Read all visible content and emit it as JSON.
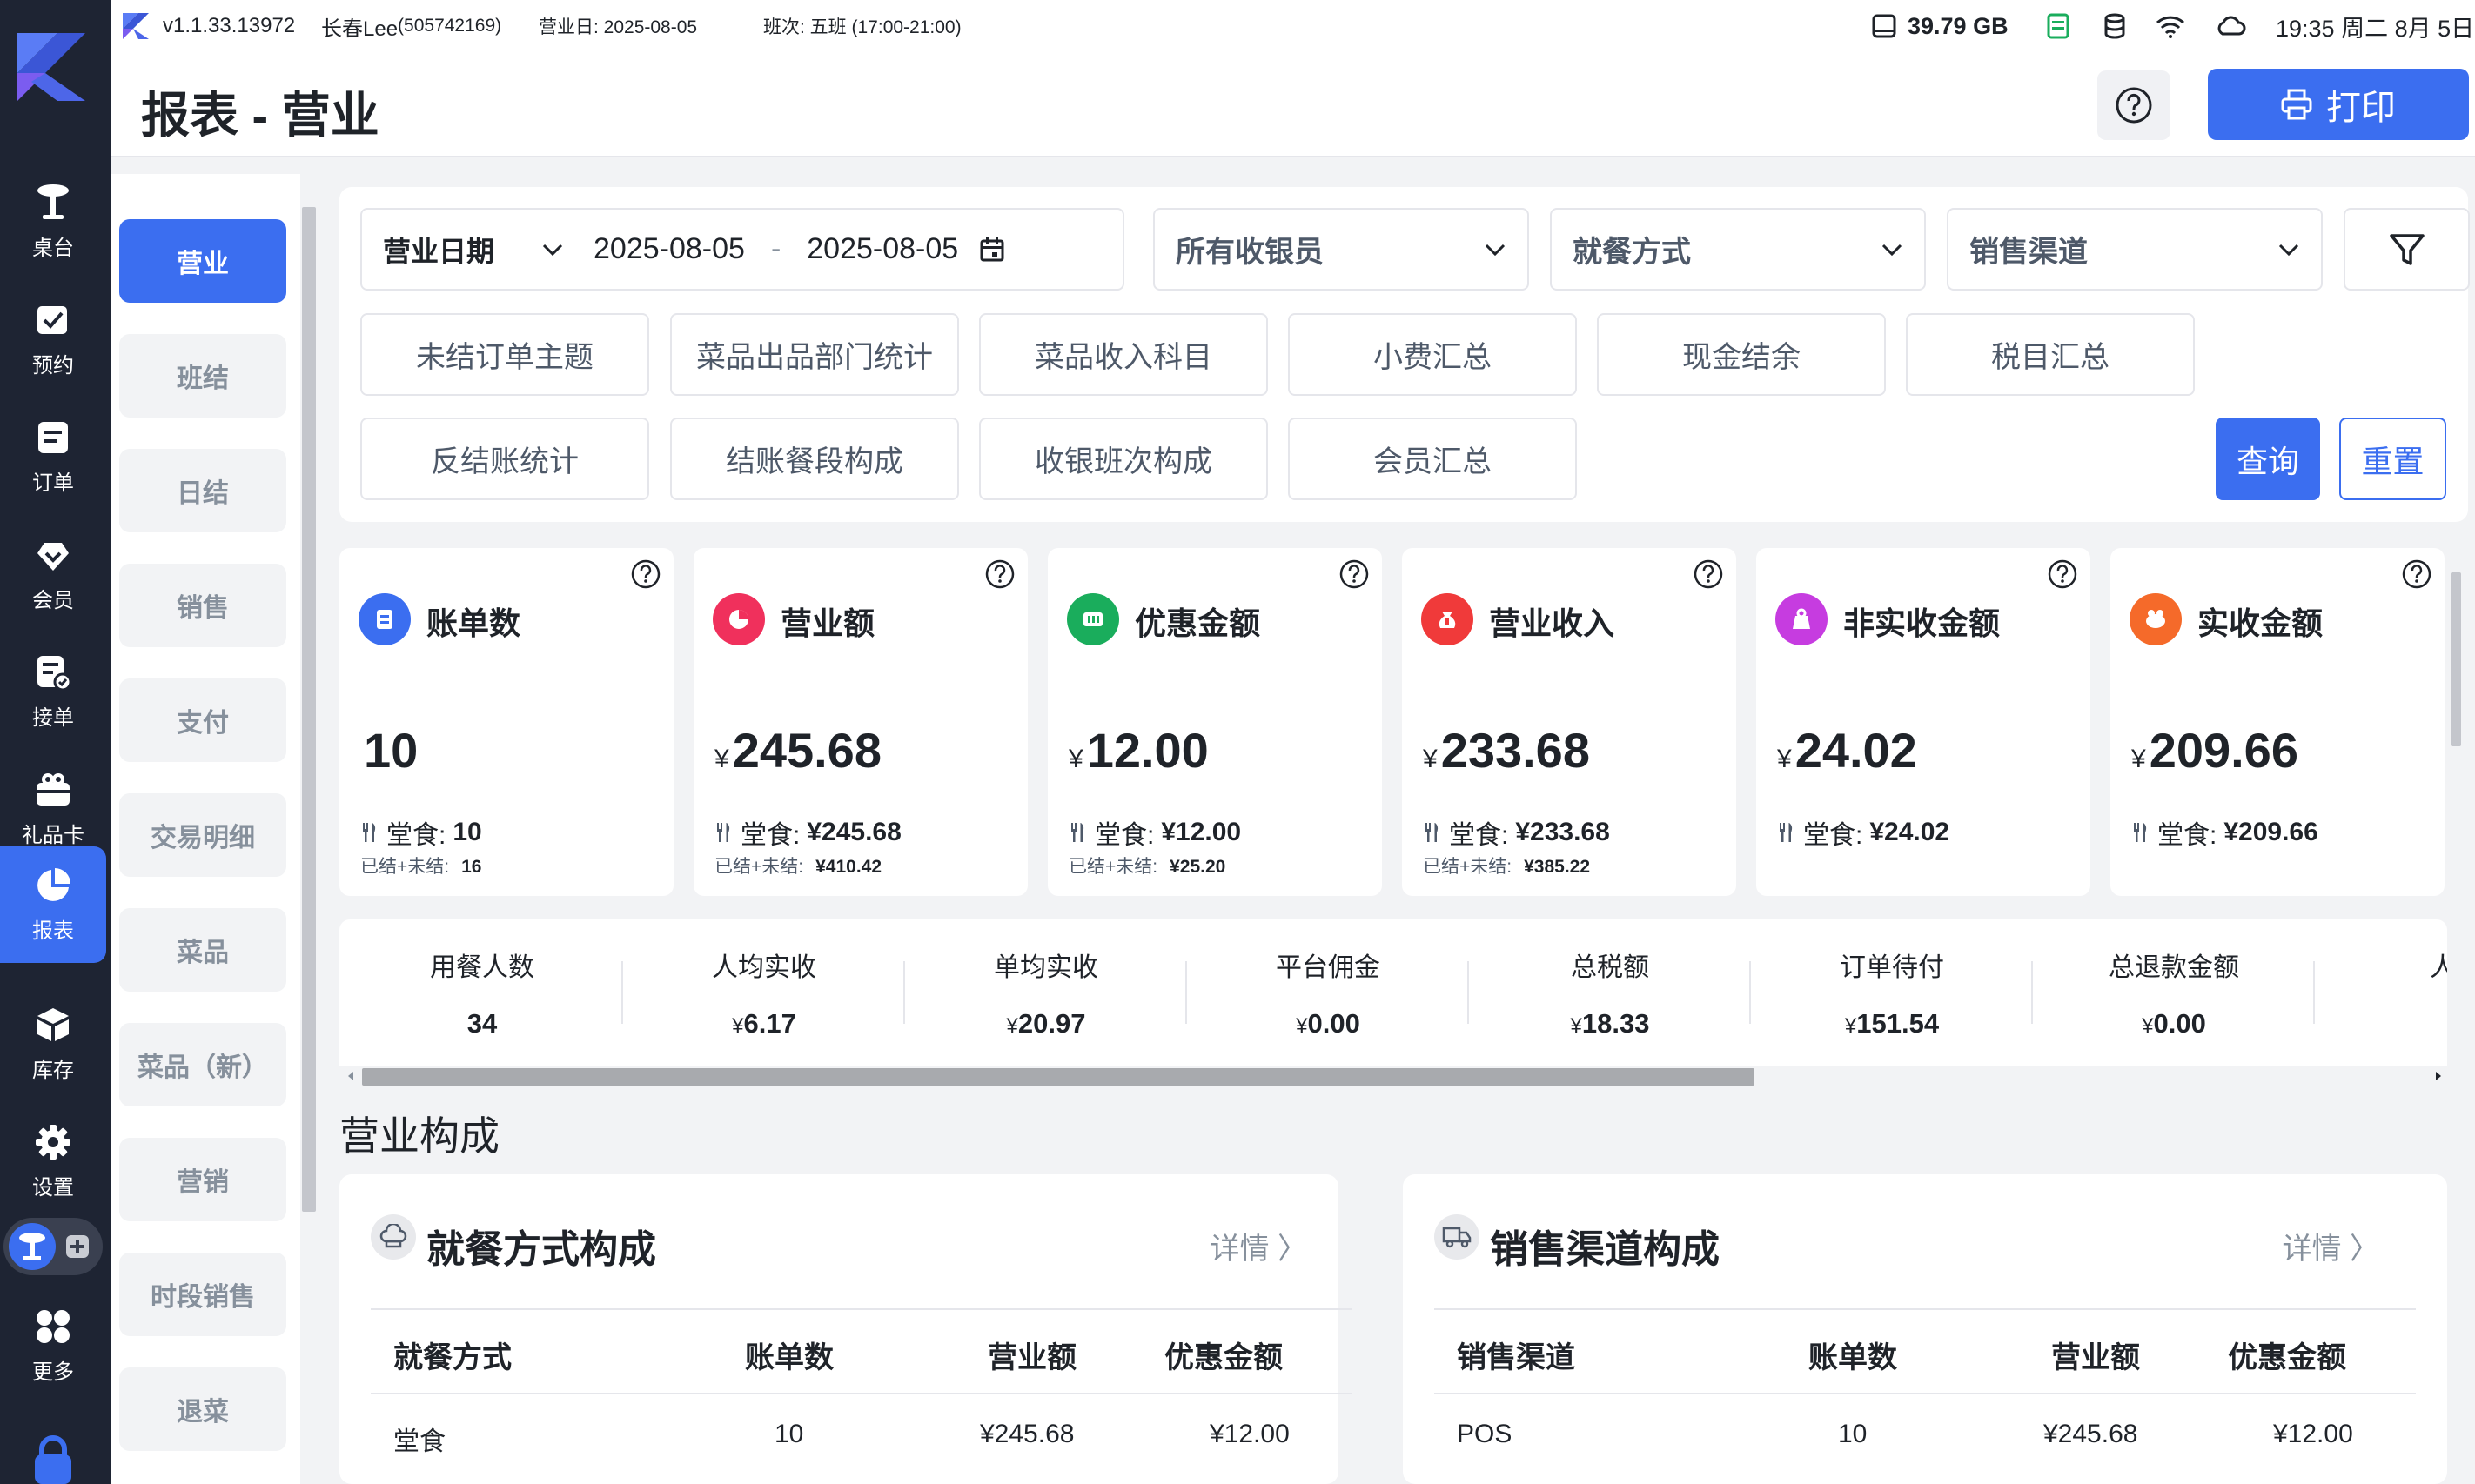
{
  "nav": {
    "items": [
      {
        "label": "桌台",
        "icon": "table-icon"
      },
      {
        "label": "预约",
        "icon": "reservation-icon"
      },
      {
        "label": "订单",
        "icon": "order-icon"
      },
      {
        "label": "会员",
        "icon": "member-icon"
      },
      {
        "label": "接单",
        "icon": "accept-order-icon"
      },
      {
        "label": "礼品卡",
        "icon": "gift-card-icon"
      },
      {
        "label": "报表",
        "icon": "report-icon"
      },
      {
        "label": "库存",
        "icon": "inventory-icon"
      },
      {
        "label": "设置",
        "icon": "settings-icon"
      },
      {
        "label": "更多",
        "icon": "more-icon"
      }
    ],
    "active": "报表"
  },
  "topbar": {
    "version": "v1.1.33.13972",
    "user": "长春Lee",
    "user_id": "(505742169)",
    "business_day": "营业日: 2025-08-05",
    "shift": "班次: 五班 (17:00-21:00)",
    "storage": "39.79 GB",
    "clock": "19:35 周二 8月 5日"
  },
  "header": {
    "title": "报表 - 营业",
    "print_label": "打印"
  },
  "subnav": [
    "营业",
    "班结",
    "日结",
    "销售",
    "支付",
    "交易明细",
    "菜品",
    "菜品（新）",
    "营销",
    "时段销售",
    "退菜"
  ],
  "filters": {
    "date_label": "营业日期",
    "date_from": "2025-08-05",
    "date_sep": "-",
    "date_to": "2025-08-05",
    "cashier": "所有收银员",
    "dining": "就餐方式",
    "channel": "销售渠道",
    "tags": [
      "未结订单主题",
      "菜品出品部门统计",
      "菜品收入科目",
      "小费汇总",
      "现金结余",
      "税目汇总",
      "反结账统计",
      "结账餐段构成",
      "收银班次构成",
      "会员汇总"
    ],
    "query_label": "查询",
    "reset_label": "重置"
  },
  "cards": [
    {
      "name": "账单数",
      "currency": "",
      "value": "10",
      "sub_label": "堂食:",
      "sub_value": "10",
      "sub2_label": "已结+未结:",
      "sub2_value": "16",
      "color": "#3b6ef0",
      "icon": "bill-icon"
    },
    {
      "name": "营业额",
      "currency": "¥",
      "value": "245.68",
      "sub_label": "堂食:",
      "sub_value": "¥245.68",
      "sub2_label": "已结+未结:",
      "sub2_value": "¥410.42",
      "color": "#f0305c",
      "icon": "revenue-icon"
    },
    {
      "name": "优惠金额",
      "currency": "¥",
      "value": "12.00",
      "sub_label": "堂食:",
      "sub_value": "¥12.00",
      "sub2_label": "已结+未结:",
      "sub2_value": "¥25.20",
      "color": "#1aad5c",
      "icon": "discount-icon"
    },
    {
      "name": "营业收入",
      "currency": "¥",
      "value": "233.68",
      "sub_label": "堂食:",
      "sub_value": "¥233.68",
      "sub2_label": "已结+未结:",
      "sub2_value": "¥385.22",
      "color": "#f03a3a",
      "icon": "income-icon"
    },
    {
      "name": "非实收金额",
      "currency": "¥",
      "value": "24.02",
      "sub_label": "堂食:",
      "sub_value": "¥24.02",
      "sub2_label": "",
      "sub2_value": "",
      "color": "#c63ce0",
      "icon": "non-received-icon"
    },
    {
      "name": "实收金额",
      "currency": "¥",
      "value": "209.66",
      "sub_label": "堂食:",
      "sub_value": "¥209.66",
      "sub2_label": "",
      "sub2_value": "",
      "color": "#f56a2a",
      "icon": "received-icon"
    }
  ],
  "metrics": [
    {
      "label": "用餐人数",
      "currency": "",
      "value": "34"
    },
    {
      "label": "人均实收",
      "currency": "¥",
      "value": "6.17"
    },
    {
      "label": "单均实收",
      "currency": "¥",
      "value": "20.97"
    },
    {
      "label": "平台佣金",
      "currency": "¥",
      "value": "0.00"
    },
    {
      "label": "总税额",
      "currency": "¥",
      "value": "18.33"
    },
    {
      "label": "订单待付",
      "currency": "¥",
      "value": "151.54"
    },
    {
      "label": "总退款金额",
      "currency": "¥",
      "value": "0.00"
    },
    {
      "label": "人均",
      "currency": "",
      "value": ""
    }
  ],
  "section_title": "营业构成",
  "composition": [
    {
      "title": "就餐方式构成",
      "more": "详情 〉",
      "icon": "chef-hat-icon",
      "headers": [
        "就餐方式",
        "账单数",
        "营业额",
        "优惠金额"
      ],
      "row": [
        "堂食",
        "10",
        "¥245.68",
        "¥12.00"
      ]
    },
    {
      "title": "销售渠道构成",
      "more": "详情 〉",
      "icon": "truck-icon",
      "headers": [
        "销售渠道",
        "账单数",
        "营业额",
        "优惠金额"
      ],
      "row": [
        "POS",
        "10",
        "¥245.68",
        "¥12.00"
      ]
    }
  ]
}
